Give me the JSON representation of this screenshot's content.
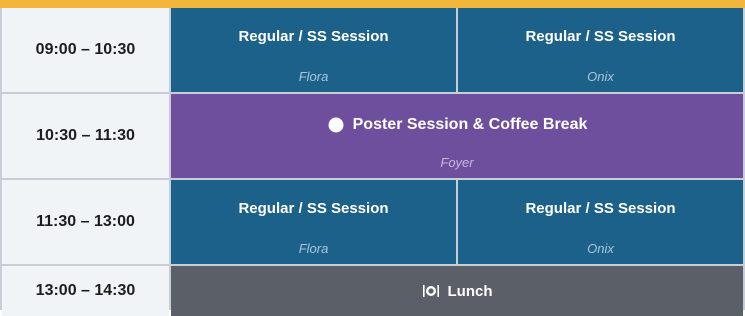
{
  "accent_color": "#f2b73a",
  "colors": {
    "regular_session": "#1c6189",
    "poster_session": "#6e4f9d",
    "lunch": "#5a5f68",
    "time_cell": "#f1f4f7"
  },
  "slots": [
    {
      "time": "09:00 – 10:30",
      "sessions": [
        {
          "title": "Regular / SS Session",
          "room": "Flora"
        },
        {
          "title": "Regular / SS Session",
          "room": "Onix"
        }
      ]
    },
    {
      "time": "10:30 – 11:30",
      "session": {
        "title": "Poster Session & Coffee Break",
        "room": "Foyer",
        "icon": "coffee-icon"
      }
    },
    {
      "time": "11:30 – 13:00",
      "sessions": [
        {
          "title": "Regular / SS Session",
          "room": "Flora"
        },
        {
          "title": "Regular / SS Session",
          "room": "Onix"
        }
      ]
    },
    {
      "time": "13:00 – 14:30",
      "session": {
        "title": "Lunch",
        "icon": "lunch-icon"
      }
    }
  ]
}
